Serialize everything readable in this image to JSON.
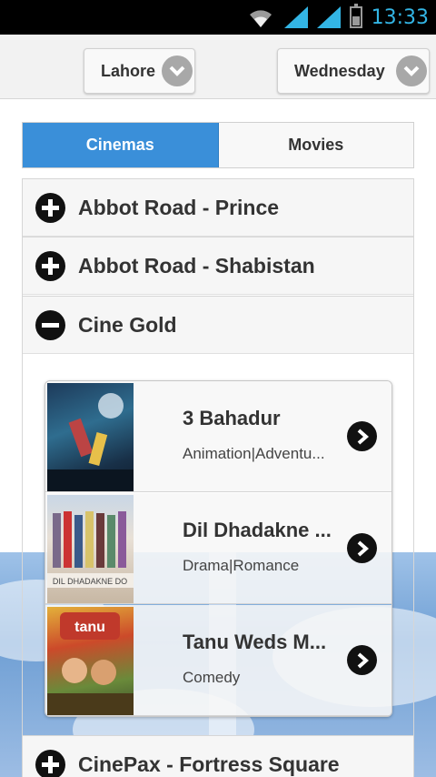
{
  "status_bar": {
    "time": "13:33"
  },
  "filters": {
    "city": "Lahore",
    "day": "Wednesday"
  },
  "tabs": [
    {
      "label": "Cinemas",
      "active": true
    },
    {
      "label": "Movies",
      "active": false
    }
  ],
  "cinemas": [
    {
      "name": "Abbot Road - Prince",
      "expanded": false
    },
    {
      "name": "Abbot Road - Shabistan",
      "expanded": false
    },
    {
      "name": "Cine Gold",
      "expanded": true
    },
    {
      "name": "CinePax - Fortress Square",
      "expanded": false
    }
  ],
  "movies": [
    {
      "title": "3 Bahadur",
      "genre": "Animation|Adventu..."
    },
    {
      "title": "Dil Dhadakne ...",
      "genre": "Drama|Romance"
    },
    {
      "title": "Tanu Weds M...",
      "genre": "Comedy"
    }
  ],
  "colors": {
    "accent": "#3a8fd9",
    "status_icon": "#33b5e5"
  }
}
